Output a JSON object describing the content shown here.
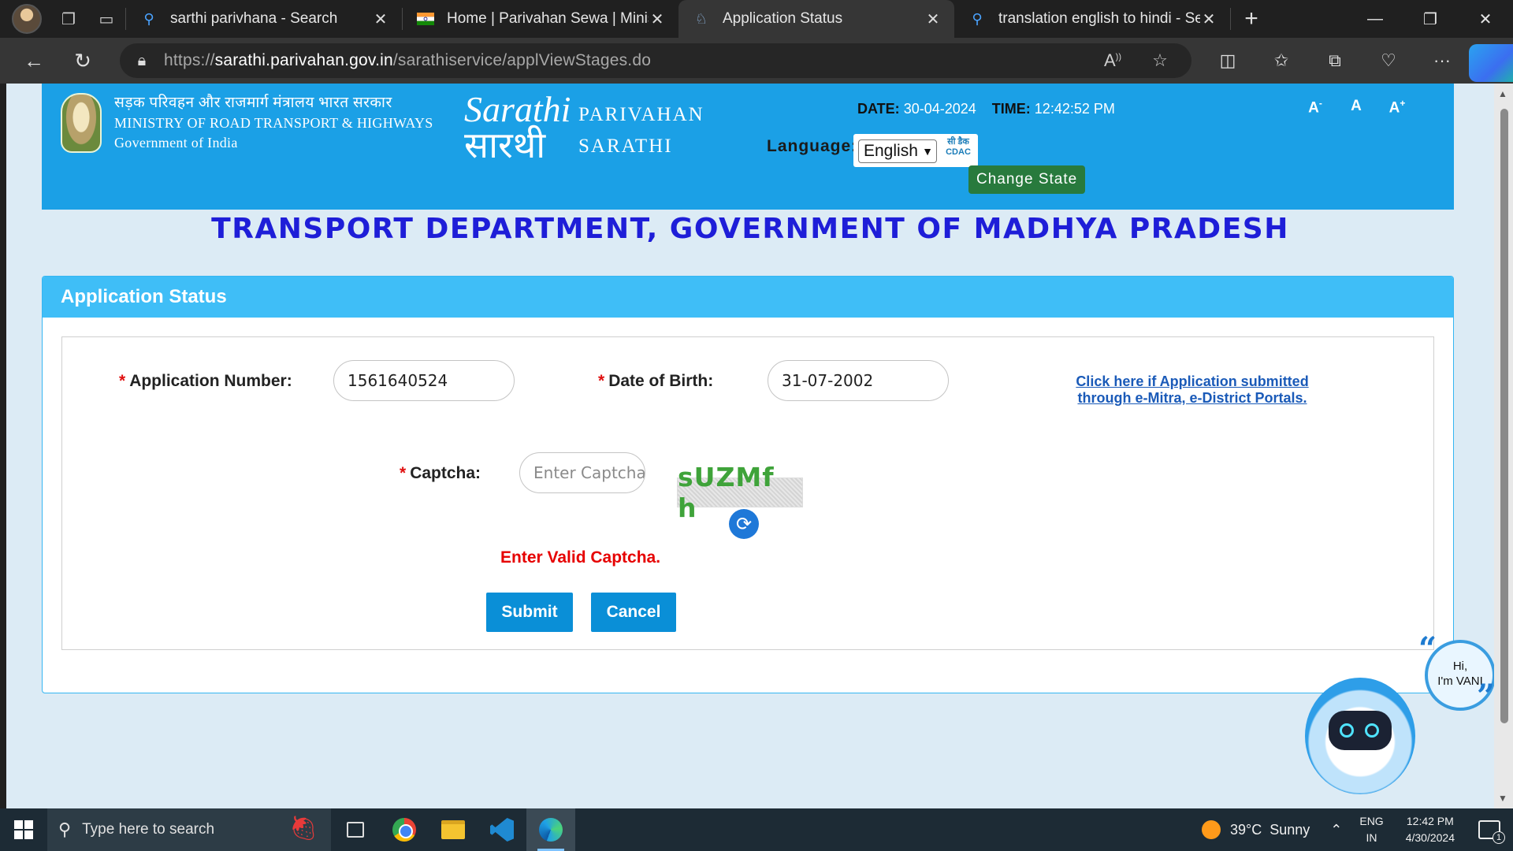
{
  "browser": {
    "tabs": [
      {
        "title": "sarthi parivhana - Search",
        "icon": "search-icon",
        "active": false
      },
      {
        "title": "Home | Parivahan Sewa | Minist",
        "icon": "india-flag-icon",
        "active": false
      },
      {
        "title": "Application Status",
        "icon": "sarathi-favicon",
        "active": true
      },
      {
        "title": "translation english to hindi - Se",
        "icon": "search-icon",
        "active": false
      }
    ],
    "url_prefix": "https://",
    "url_host": "sarathi.parivahan.gov.in",
    "url_path": "/sarathiservice/applViewStages.do"
  },
  "header": {
    "ministry_hindi": "सड़क परिवहन और राजमार्ग मंत्रालय भारत सरकार",
    "ministry_en": "MINISTRY OF ROAD TRANSPORT & HIGHWAYS",
    "gov": "Government of India",
    "logo_text_en": "Sarathi",
    "logo_text_hi": "सारथी",
    "brand_line1": "PARIVAHAN",
    "brand_line2": "SARATHI",
    "date_label": "DATE:",
    "date_value": "30-04-2024",
    "time_label": "TIME:",
    "time_value": "12:42:52 PM",
    "font_small": "A",
    "font_small_sup": "-",
    "font_normal": "A",
    "font_large": "A",
    "font_large_sup": "+",
    "language_label": "Language:",
    "language_value": "English",
    "cdac_hi": "सी डैक",
    "cdac_en": "CDAC",
    "change_state": "Change State"
  },
  "department_title": "TRANSPORT DEPARTMENT, GOVERNMENT OF MADHYA PRADESH",
  "panel": {
    "title": "Application Status",
    "required_mark": "*",
    "app_number_label": "Application Number:",
    "app_number_value": "1561640524",
    "dob_label": "Date of Birth:",
    "dob_value": "31-07-2002",
    "emitra_link_line1": "Click here if Application submitted",
    "emitra_link_line2": "through e-Mitra, e-District Portals.",
    "captcha_label": "Captcha:",
    "captcha_placeholder": "Enter Captcha",
    "captcha_text": "sUZMf h",
    "error": "Enter Valid Captcha.",
    "submit": "Submit",
    "cancel": "Cancel"
  },
  "vani": {
    "line1": "Hi,",
    "line2": "I'm VANI"
  },
  "taskbar": {
    "search_placeholder": "Type here to search",
    "temperature": "39°C",
    "weather": "Sunny",
    "lang_line1": "ENG",
    "lang_line2": "IN",
    "time": "12:42 PM",
    "date": "4/30/2024",
    "notification_count": "1"
  }
}
